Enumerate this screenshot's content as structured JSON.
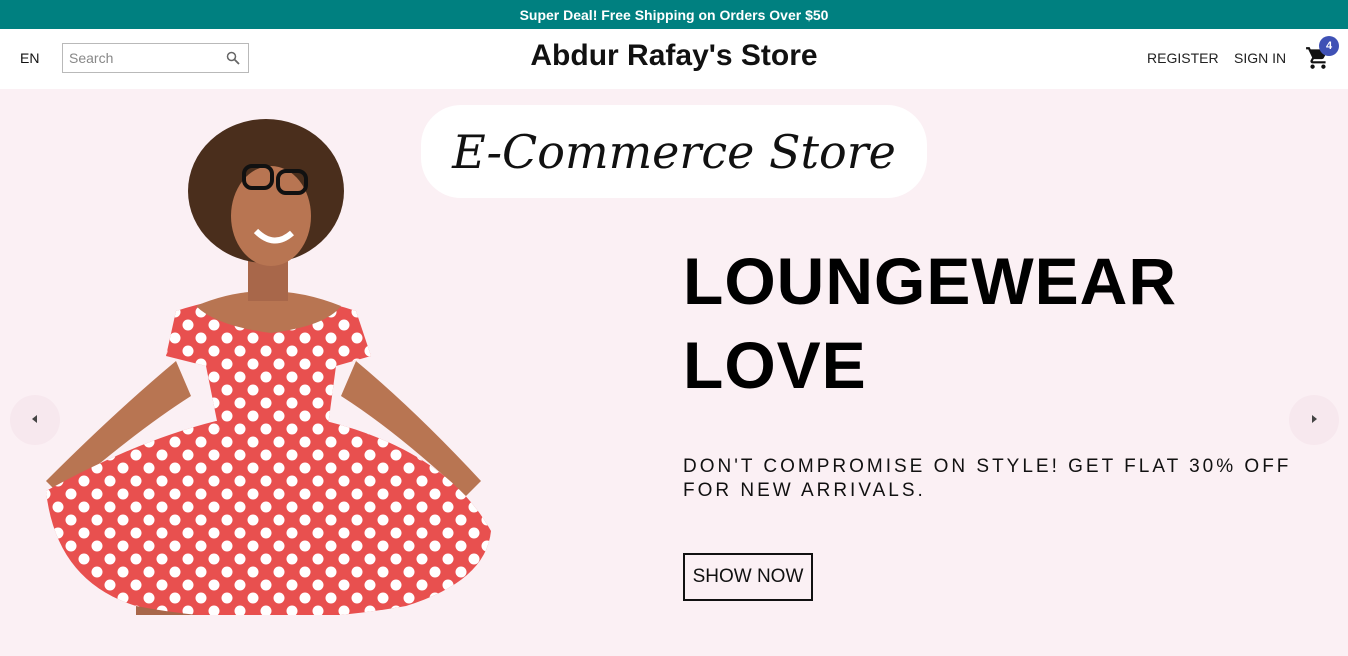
{
  "announcement": {
    "text": "Super Deal! Free Shipping on Orders Over $50"
  },
  "navbar": {
    "language": "EN",
    "search": {
      "placeholder": "Search",
      "value": ""
    },
    "logo": "Abdur Rafay's Store",
    "register_label": "REGISTER",
    "signin_label": "SIGN IN",
    "cart": {
      "count": "4",
      "icon": "shopping-cart-icon"
    }
  },
  "hero": {
    "banner_text": "E-Commerce Store",
    "headline_line1": "LOUNGEWEAR",
    "headline_line2": "LOVE",
    "subtitle": "DON'T COMPROMISE ON STYLE! GET FLAT 30% OFF FOR NEW ARRIVALS.",
    "cta_label": "SHOW NOW",
    "prev_icon": "arrow-left-icon",
    "next_icon": "arrow-right-icon"
  },
  "colors": {
    "announcement_bg": "#008080",
    "hero_bg": "#fbf0f4",
    "cart_badge": "#3f51b5",
    "dress": "#e8504f"
  }
}
